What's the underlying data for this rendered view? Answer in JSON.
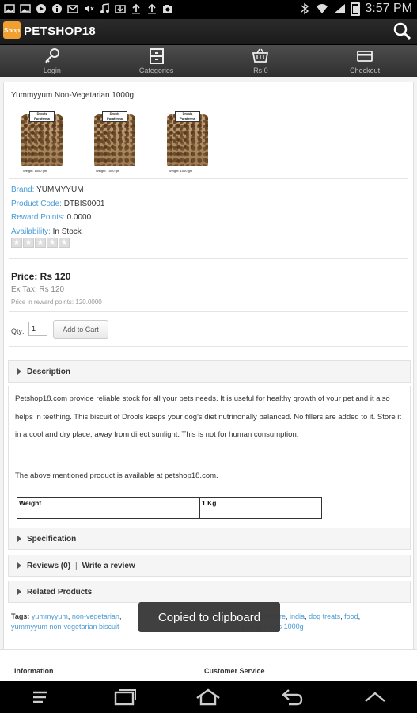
{
  "status_bar": {
    "time": "3:57 PM",
    "icons": [
      "image-icon",
      "image-icon",
      "play-icon",
      "info-icon",
      "mail-icon",
      "mute-icon",
      "music-icon",
      "download-icon",
      "upload-icon",
      "upload-icon",
      "camera-icon",
      "bluetooth-icon",
      "wifi-icon",
      "signal-icon",
      "battery-icon"
    ]
  },
  "app_bar": {
    "logo_text": "Shop",
    "title": "PETSHOP18"
  },
  "nav": [
    {
      "label": "Login",
      "icon": "key-icon"
    },
    {
      "label": "Categories",
      "icon": "drawer-icon"
    },
    {
      "label": "Rs 0",
      "icon": "cart-icon"
    },
    {
      "label": "Checkout",
      "icon": "card-icon"
    }
  ],
  "product": {
    "title": "Yummyyum Non-Vegetarian 1000g",
    "thumbs": [
      {
        "brand": "Drools Puraferma",
        "weight": "Weight: 1000 gm"
      },
      {
        "brand": "Drools Puraferma",
        "weight": "Weight: 1000 gm"
      },
      {
        "brand": "Drools Puraferma",
        "weight": "Weight: 1000 gm"
      }
    ],
    "brand_label": "Brand:",
    "brand_value": "YUMMYYUM",
    "code_label": "Product Code:",
    "code_value": "DTBIS0001",
    "reward_label": "Reward Points:",
    "reward_value": "0.0000",
    "availability_label": "Availability:",
    "availability_value": "In Stock",
    "rating_stars": 0,
    "price": "Price: Rs 120",
    "ex_tax": "Ex Tax: Rs 120",
    "reward_price": "Price in reward points: 120.0000",
    "qty_label": "Qty:",
    "qty_value": "1",
    "add_to_cart": "Add to Cart"
  },
  "sections": {
    "description": "Description",
    "specification": "Specification",
    "reviews": "Reviews (0)",
    "write_review": "Write a review",
    "related": "Related Products"
  },
  "description": {
    "para1": "Petshop18.com provide reliable stock for all your pets needs. It is useful for healthy growth of your pet and it also helps in teething. This biscuit of Drools keeps your dog's diet nutrinonally balanced. No fillers are added to it. Store it in a cool and dry place, away from direct sunlight. This is not for human consumption.",
    "para2": "The above mentioned product is available at petshop18.com.",
    "table": [
      [
        "Weight",
        "1 Kg"
      ]
    ]
  },
  "tags": {
    "label": "Tags:",
    "items": [
      "yummyyum",
      "non-vegetarian",
      "p",
      "petstore",
      "india",
      "dog treats",
      "food",
      "yummyyum non-vegetarian biscuit",
      "p",
      "dog-treats 1000g"
    ]
  },
  "footer": {
    "col1": "Information",
    "col2": "Customer Service"
  },
  "toast": "Copied to clipboard",
  "system_nav": [
    "menu-icon",
    "recent-apps-icon",
    "home-icon",
    "back-icon",
    "collapse-icon"
  ]
}
